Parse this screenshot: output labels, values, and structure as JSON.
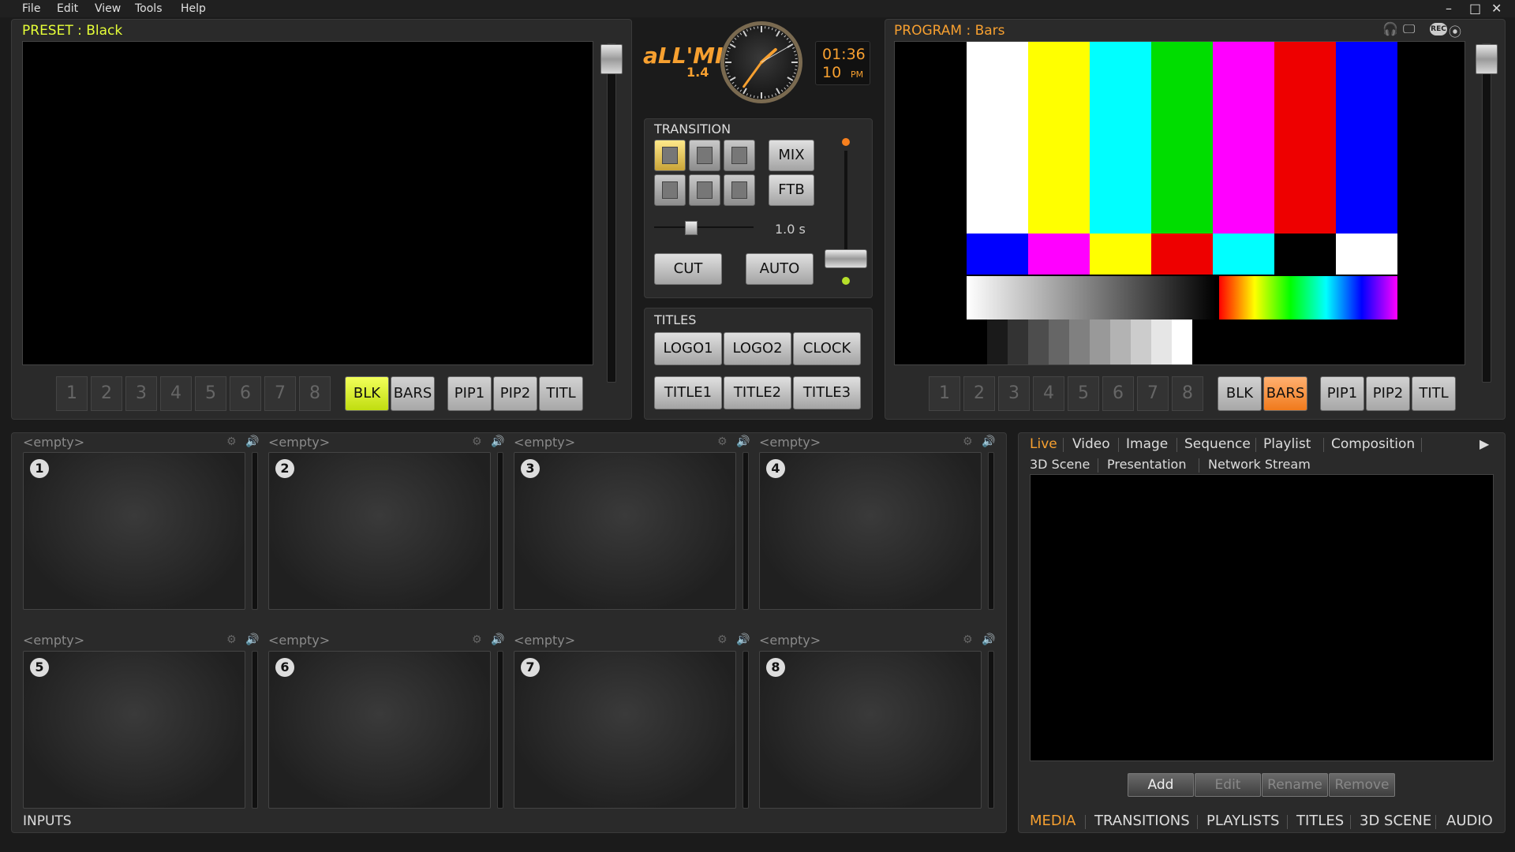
{
  "menu": {
    "items": [
      "File",
      "Edit",
      "View",
      "Tools",
      "Help"
    ]
  },
  "window_controls": {
    "minimize": "–",
    "maximize": "□",
    "close": "✕"
  },
  "preset": {
    "title": "PRESET : Black",
    "title_color": "#e6ff38",
    "numbers": [
      "1",
      "2",
      "3",
      "4",
      "5",
      "6",
      "7",
      "8"
    ],
    "sources": [
      "BLK",
      "BARS"
    ],
    "overlays": [
      "PIP1",
      "PIP2",
      "TITL"
    ],
    "active": "BLK"
  },
  "program": {
    "title": "PROGRAM : Bars",
    "title_color": "#f7a030",
    "numbers": [
      "1",
      "2",
      "3",
      "4",
      "5",
      "6",
      "7",
      "8"
    ],
    "sources": [
      "BLK",
      "BARS"
    ],
    "overlays": [
      "PIP1",
      "PIP2",
      "TITL"
    ],
    "active": "BARS",
    "icons": [
      "headphones-icon",
      "monitor-icon",
      "rec-icon",
      "broadcast-icon"
    ],
    "rec_label": "REC"
  },
  "app": {
    "logo": "aLL'MIX",
    "version": "1.4"
  },
  "clock": {
    "time": "01:36",
    "seconds": "10",
    "ampm": "PM",
    "hour": 1,
    "minute": 36,
    "second": 10
  },
  "transition": {
    "label": "TRANSITION",
    "mix": "MIX",
    "ftb": "FTB",
    "duration": "1.0 s",
    "cut": "CUT",
    "auto": "AUTO",
    "duration_level": 0.35,
    "tbar_level": 0.0
  },
  "titles": {
    "label": "TITLES",
    "row1": [
      "LOGO1",
      "LOGO2",
      "CLOCK"
    ],
    "row2": [
      "TITLE1",
      "TITLE2",
      "TITLE3"
    ]
  },
  "inputs": {
    "label": "INPUTS",
    "placeholder": "<empty>",
    "slots": [
      {
        "n": "1"
      },
      {
        "n": "2"
      },
      {
        "n": "3"
      },
      {
        "n": "4"
      },
      {
        "n": "5"
      },
      {
        "n": "6"
      },
      {
        "n": "7"
      },
      {
        "n": "8"
      }
    ]
  },
  "media": {
    "tabs_row1": [
      "Live",
      "Video",
      "Image",
      "Sequence",
      "Playlist",
      "Composition"
    ],
    "tabs_row2": [
      "3D Scene",
      "Presentation",
      "Network Stream"
    ],
    "active_tab": "Live",
    "buttons": [
      "Add",
      "Edit",
      "Rename",
      "Remove"
    ]
  },
  "bottom_tabs": {
    "items": [
      "MEDIA",
      "TRANSITIONS",
      "PLAYLISTS",
      "TITLES",
      "3D SCENE",
      "AUDIO"
    ],
    "active": "MEDIA"
  },
  "colors": {
    "accent_orange": "#f7a030",
    "accent_green": "#e6ff38"
  }
}
